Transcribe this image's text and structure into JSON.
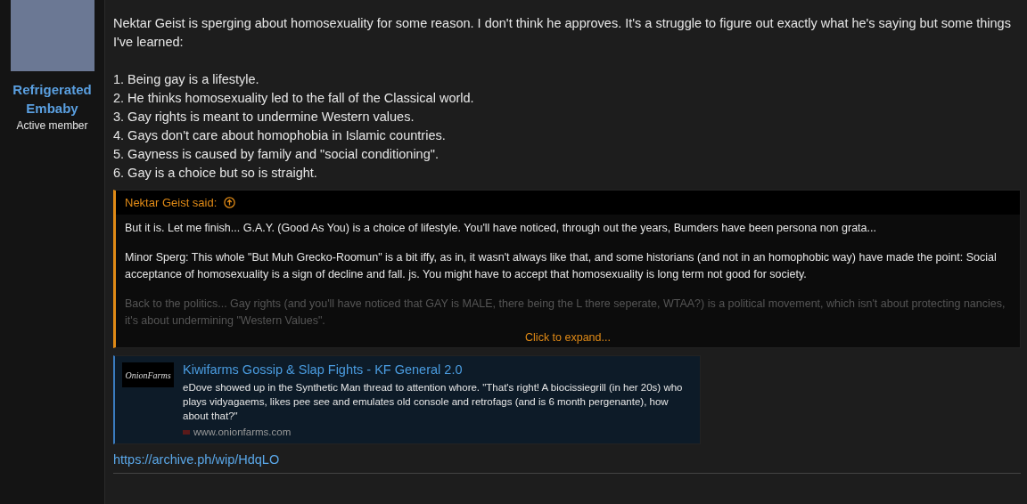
{
  "user": {
    "name": "Refrigerated Embaby",
    "title": "Active member"
  },
  "post": {
    "intro": "Nektar Geist is sperging about homosexuality for some reason. I don't think he approves. It's a struggle to figure out exactly what he's saying but some things I've learned:",
    "points": [
      "1. Being gay is a lifestyle.",
      "2. He thinks homosexuality led to the fall of the Classical world.",
      "3. Gay rights is meant to undermine Western values.",
      "4. Gays don't care about homophobia in Islamic countries.",
      "5. Gayness is caused by family and \"social conditioning\".",
      "6. Gay is a choice but so is straight."
    ],
    "quote": {
      "author": "Nektar Geist said:",
      "paragraphs": [
        "But it is. Let me finish... G.A.Y. (Good As You) is a choice of lifestyle. You'll have noticed, through out the years, Bumders have been persona non grata...",
        "Minor Sperg: This whole \"But Muh Grecko-Roomun\" is a bit iffy, as in, it wasn't always like that, and some historians (and not in an homophobic way) have made the point: Social acceptance of homosexuality is a sign of decline and fall. js. You might have to accept that homosexuality is long term not good for society."
      ],
      "faded": "Back to the politics... Gay rights (and you'll have noticed that GAY is MALE, there being the L there seperate, WTAA?) is a political movement, which isn't about protecting nancies, it's about undermining \"Western Values\".",
      "expand": "Click to expand..."
    },
    "unfurl": {
      "logo": "OnionFarms",
      "title": "Kiwifarms Gossip & Slap Fights - KF General 2.0",
      "description": "eDove showed up in the Synthetic Man thread to attention whore. \"That's right! A biocissiegrill (in her 20s) who plays vidyagaems, likes pee see and emulates old console and retrofags (and is 6 month pergenante), how about that?\"",
      "domain": "www.onionfarms.com"
    },
    "link": "https://archive.ph/wip/HdqLO"
  }
}
